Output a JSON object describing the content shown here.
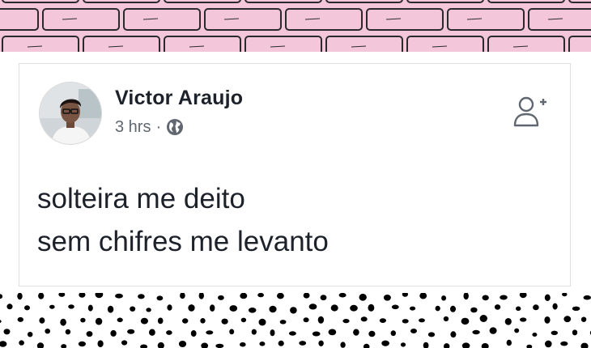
{
  "post": {
    "author_name": "Victor Araujo",
    "timestamp": "3 hrs",
    "separator": "·",
    "privacy_icon": "globe-icon",
    "add_friend_icon": "add-friend-icon",
    "text_lines": [
      "solteira me deito",
      "sem chifres me levanto"
    ]
  },
  "decor": {
    "top_band": "pink-brick-pattern",
    "bottom_band": "black-polka-dot-pattern"
  },
  "colors": {
    "brick_fill": "#f4c6da",
    "mortar": "#2a2a2a",
    "name_text": "#1d2129",
    "meta_text": "#606770",
    "card_border": "#dddfe2",
    "dot": "#000000"
  }
}
